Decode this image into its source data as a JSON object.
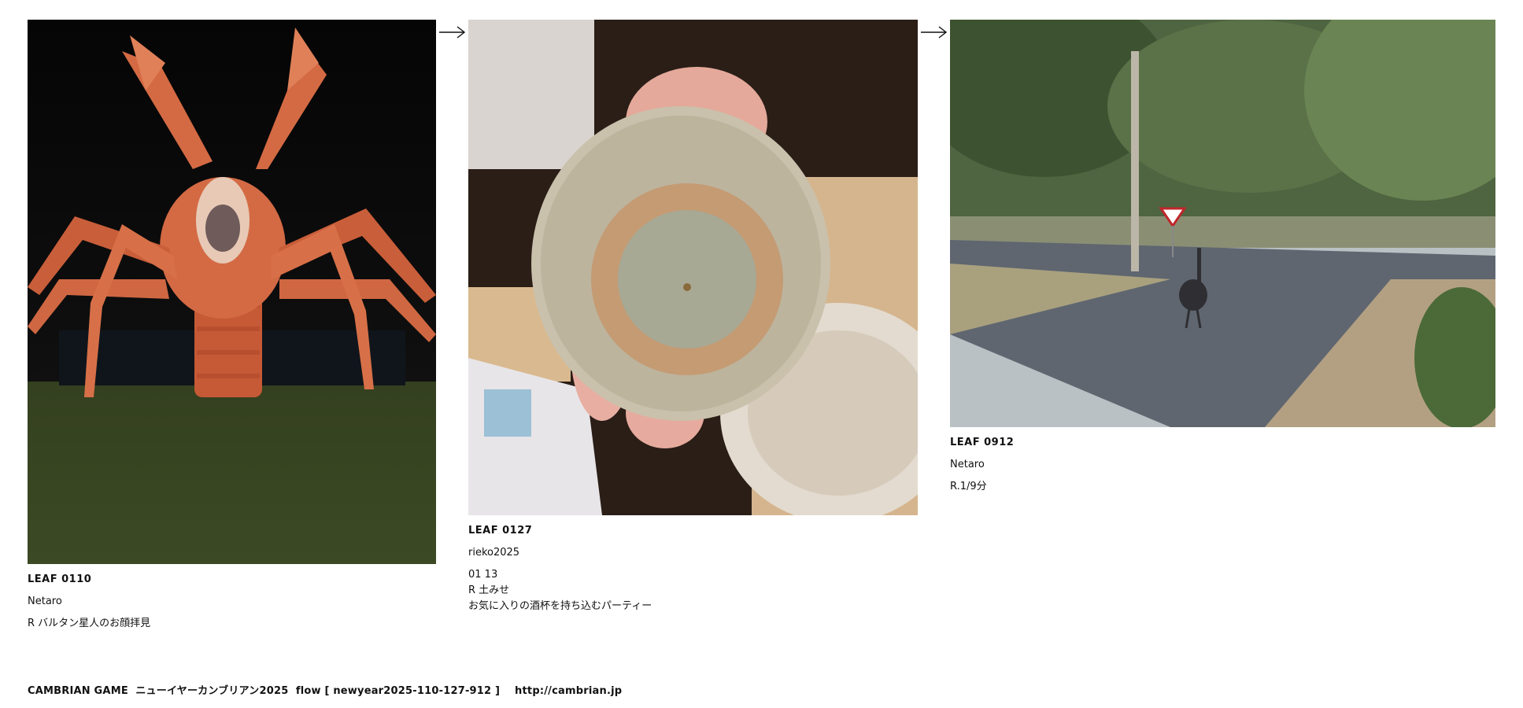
{
  "leaves": [
    {
      "id": "LEAF 0110",
      "author": "Netaro",
      "lines": [
        "R バルタン星人のお顔拝見"
      ],
      "image": "giant-lobster-sculpture-at-night"
    },
    {
      "id": "LEAF 0127",
      "author": "rieko2025",
      "lines": [
        "01 13",
        "R 土みせ",
        "お気に入りの酒杯を持ち込むパーティー"
      ],
      "image": "hand-holding-ceramic-sake-cup-bottom"
    },
    {
      "id": "LEAF 0912",
      "author": "Netaro",
      "lines": [
        "R.1/9分"
      ],
      "image": "emu-on-country-road"
    }
  ],
  "arrow_icon": "right-arrow-icon",
  "footer": "CAMBRIAN GAME  ニューイヤーカンブリアン2025  flow [ newyear2025-110-127-912 ]    http://cambrian.jp"
}
